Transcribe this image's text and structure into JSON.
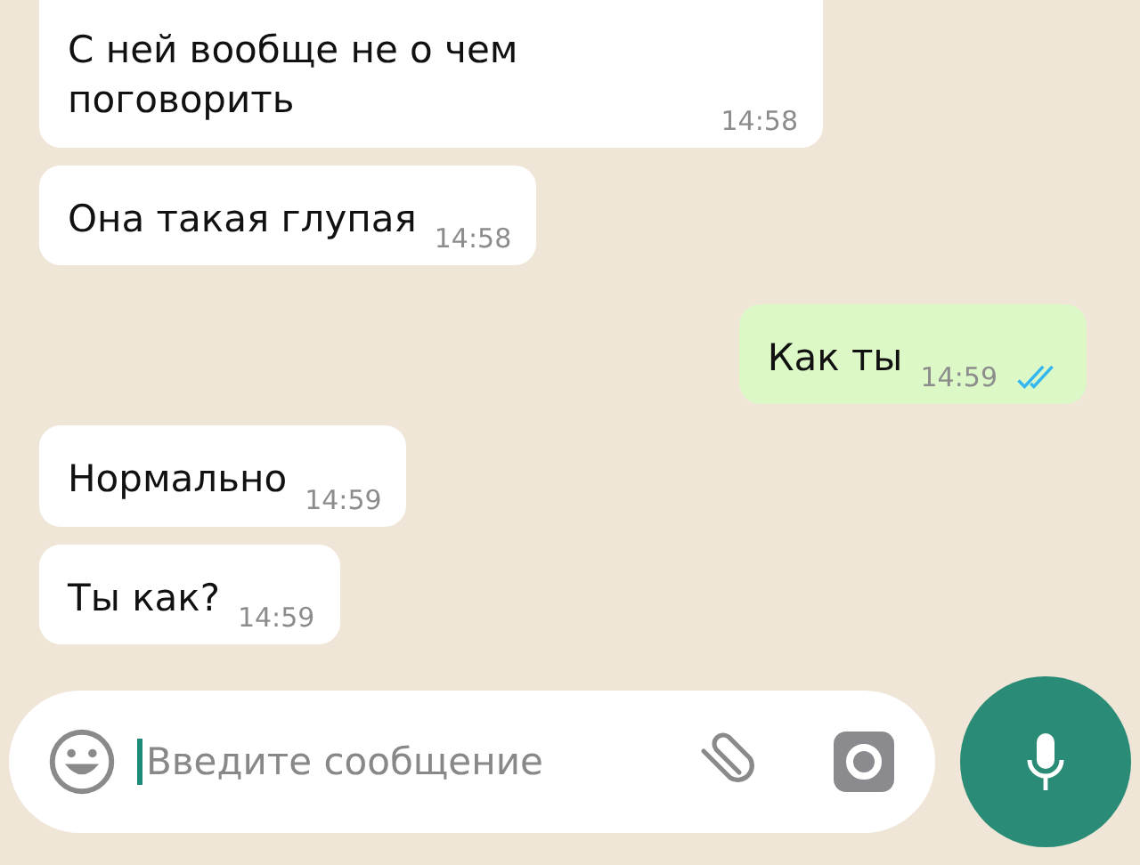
{
  "messages": [
    {
      "kind": "incoming",
      "text": "С ней вообще не о чем поговорить",
      "time": "14:58"
    },
    {
      "kind": "incoming",
      "text": "Она такая глупая",
      "time": "14:58"
    },
    {
      "kind": "outgoing",
      "text": "Как ты",
      "time": "14:59",
      "read": true
    },
    {
      "kind": "incoming",
      "text": "Нормально",
      "time": "14:59"
    },
    {
      "kind": "incoming",
      "text": "Ты как?",
      "time": "14:59"
    }
  ],
  "composer": {
    "placeholder": "Введите сообщение"
  }
}
